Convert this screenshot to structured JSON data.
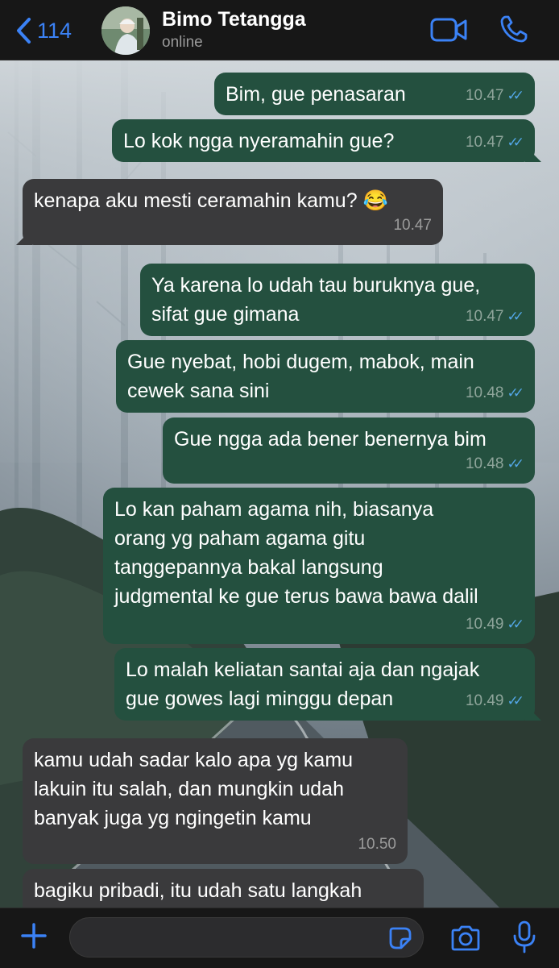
{
  "header": {
    "back_count": "114",
    "contact_name": "Bimo Tetangga",
    "status": "online"
  },
  "colors": {
    "accent": "#3b82f6",
    "outgoing_bubble": "#24503f",
    "incoming_bubble": "#3a3a3c",
    "read_ticks": "#53a6e6"
  },
  "messages": [
    {
      "direction": "out",
      "lines": [
        "Bim, gue penasaran"
      ],
      "time": "10.47",
      "ticks": "✓✓"
    },
    {
      "direction": "out",
      "lines": [
        "Lo kok ngga nyeramahin gue?"
      ],
      "time": "10.47",
      "ticks": "✓✓"
    },
    {
      "direction": "in",
      "lines": [
        "kenapa aku mesti ceramahin kamu? 😂"
      ],
      "time": "10.47"
    },
    {
      "direction": "out",
      "lines": [
        "Ya karena lo udah tau buruknya gue,",
        "sifat gue gimana"
      ],
      "time": "10.47",
      "ticks": "✓✓"
    },
    {
      "direction": "out",
      "lines": [
        "Gue nyebat, hobi dugem, mabok, main",
        "cewek sana sini"
      ],
      "time": "10.48",
      "ticks": "✓✓"
    },
    {
      "direction": "out",
      "lines": [
        "Gue ngga ada bener benernya bim"
      ],
      "time": "10.48",
      "ticks": "✓✓"
    },
    {
      "direction": "out",
      "lines": [
        "Lo kan paham agama nih, biasanya",
        "orang yg paham agama gitu",
        "tanggepannya bakal langsung",
        "judgmental ke gue terus bawa bawa dalil"
      ],
      "time": "10.49",
      "ticks": "✓✓"
    },
    {
      "direction": "out",
      "lines": [
        "Lo malah keliatan santai aja dan ngajak",
        "gue gowes lagi minggu depan"
      ],
      "time": "10.49",
      "ticks": "✓✓"
    },
    {
      "direction": "in",
      "lines": [
        "kamu udah sadar kalo apa yg kamu",
        "lakuin itu salah, dan mungkin udah",
        "banyak juga yg ngingetin kamu"
      ],
      "time": "10.50"
    },
    {
      "direction": "in",
      "lines": [
        "bagiku pribadi, itu udah satu langkah"
      ],
      "time": ""
    }
  ],
  "input": {
    "value": "",
    "placeholder": ""
  },
  "icons": [
    "chevron-left-icon",
    "video-icon",
    "phone-icon",
    "plus-icon",
    "sticker-icon",
    "camera-icon",
    "microphone-icon"
  ]
}
